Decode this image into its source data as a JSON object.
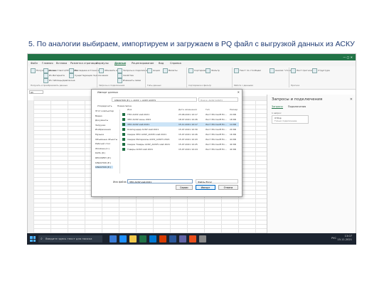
{
  "slide_title": "5. По аналогии выбираем, импортируем и загружаем в PQ файл с выгрузкой данных из АСКУ",
  "colors": {
    "excel_green": "#217346",
    "taskbar": "#1c2430",
    "selection": "#cce4f7"
  },
  "ribbon": {
    "tabs": [
      "Файл",
      "Главная",
      "Вставка",
      "Разметка страницы",
      "Формулы",
      "Данные",
      "Рецензирование",
      "Вид",
      "Справка"
    ],
    "active_tab": "Данные",
    "buttons": [
      "Получить данные",
      "Из текстового/CSV-файла",
      "Из Интернета",
      "Из таблицы/диапазона",
      "Последние источники",
      "Существующие подключения",
      "Обновить все",
      "Запросы и подключения",
      "Свойства",
      "Изменить связи",
      "Акции",
      "Валюты",
      "Сортировка",
      "Фильтр",
      "Текст по столбцам",
      "Анализ \"что если\"",
      "Лист прогноза",
      "Структура"
    ],
    "groups": [
      "Получить и преобразовать данные",
      "Запросы и подключения",
      "Типы данных",
      "Сортировка и фильтр",
      "Работа с данными",
      "Прогноз"
    ]
  },
  "namebox": "A1",
  "sheet_tab": "Лист1",
  "pane": {
    "title": "Запросы и подключения",
    "tabs": [
      "Запросы",
      "Подключения"
    ],
    "count": "1 запрос",
    "query_name": "Отбор",
    "query_status": "Только подключение."
  },
  "dialog": {
    "title": "Импорт данных",
    "address": "KINGSTON (E:) > АСКУ > АСКУ АСКУЧ",
    "search_placeholder": "Поиск: АСКУ АСКУЧ",
    "toolbar": [
      "Упорядочить",
      "Новая папка"
    ],
    "nav": [
      "Этот компьютер",
      "Видео",
      "Документы",
      "Загрузки",
      "Изображения",
      "Музыка",
      "Объемные объекты",
      "Рабочий стол",
      "Windows (C:)",
      "DATA (D:)",
      "RECOVERY (E:)",
      "KINGSTON (E:)",
      "KINGSTON (E:)"
    ],
    "nav_selected": 12,
    "columns": [
      "Имя",
      "Дата изменения",
      "Тип",
      "Размер"
    ],
    "files": [
      {
        "name": "ТПО АСКУ май 2021",
        "date": "23.06.2021 10:17",
        "type": "Лист Microsoft Ex...",
        "size": "24 КБ"
      },
      {
        "name": "ЗПО АСКУ июнь 2021",
        "date": "18.07.2021 10:26",
        "type": "Лист Microsoft Ex...",
        "size": "18 КБ"
      },
      {
        "name": "ЗПО АСКУ май 2021",
        "date": "15.11.2021 10:17",
        "type": "Лист Microsoft Ex...",
        "size": "14 КБ"
      },
      {
        "name": "Компаундер АСКУ май 2021",
        "date": "15.07.2021 10:30",
        "type": "Лист Microsoft Ex...",
        "size": "20 КБ"
      },
      {
        "name": "Сверка ЗПО АСКУ_АСКУЧ май 2021",
        "date": "15.07.2021 10:26",
        "type": "Лист Microsoft Ex...",
        "size": "16 КБ"
      },
      {
        "name": "Сверка Материалы АСКУ_АСКУЧ 2021",
        "date": "15.07.2021 10:43",
        "type": "Лист Microsoft Ex...",
        "size": "44 КБ"
      },
      {
        "name": "Сверка Товары АСКУ_АСКУЧ май 2021",
        "date": "15.07.2021 10:25",
        "type": "Лист Microsoft Ex...",
        "size": "40 КБ"
      },
      {
        "name": "Товары АСКУ май 2021",
        "date": "15.07.2021 10:24",
        "type": "Лист Microsoft Ex...",
        "size": "40 КБ"
      }
    ],
    "selected_file": 2,
    "filename_label": "Имя файла:",
    "filename_value": "ЗПО АСКУ май 2021",
    "filter_value": "Файлы Excel",
    "service_label": "Сервис",
    "open_label": "Импорт",
    "cancel_label": "Отмена"
  },
  "taskbar": {
    "search_placeholder": "Введите здесь текст для поиска",
    "lang": "РУС",
    "time": "13:07",
    "date": "15.11.2021"
  }
}
